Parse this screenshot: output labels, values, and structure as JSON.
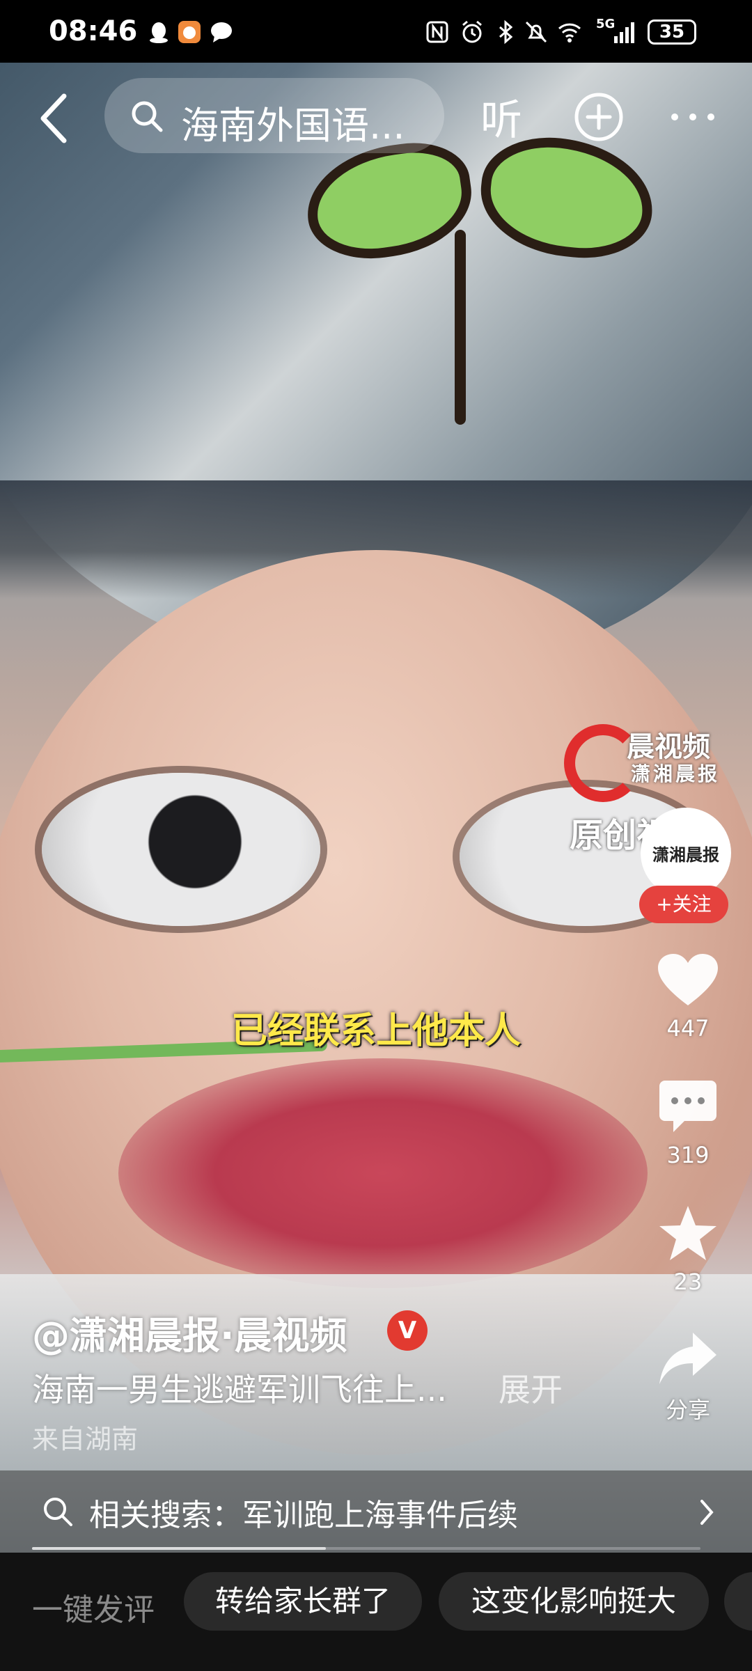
{
  "status_bar": {
    "time": "08:46",
    "network": "5G",
    "battery": "35"
  },
  "top_nav": {
    "search_query": "海南外国语...",
    "listen_label": "听",
    "icons": [
      "back-icon",
      "search-icon",
      "plus-circle-icon",
      "more-icon"
    ]
  },
  "video": {
    "subtitle": "已经联系上他本人",
    "watermark": {
      "brand": "晨视频",
      "publisher": "潇湘晨报",
      "tag": "原创视频"
    }
  },
  "right_rail": {
    "avatar_text": "潇湘晨报",
    "follow_label": "+关注",
    "likes": "447",
    "comments": "319",
    "favorites": "23",
    "share_label": "分享"
  },
  "caption": {
    "author": "@潇湘晨报·晨视频",
    "verified_badge": "V",
    "description": "海南一男生逃避军训飞往上...",
    "expand_label": "展开",
    "location": "来自湖南"
  },
  "related_search": {
    "text": "相关搜索：军训跑上海事件后续"
  },
  "playback": {
    "progress": 0.44
  },
  "bottom_bar": {
    "quick_comment_label": "一键发评",
    "chips": [
      "转给家长群了",
      "这变化影响挺大"
    ]
  },
  "colors": {
    "follow_red": "#e5423e",
    "subtitle_yellow": "#ffe94a",
    "bottom_bar_bg": "#121212"
  }
}
